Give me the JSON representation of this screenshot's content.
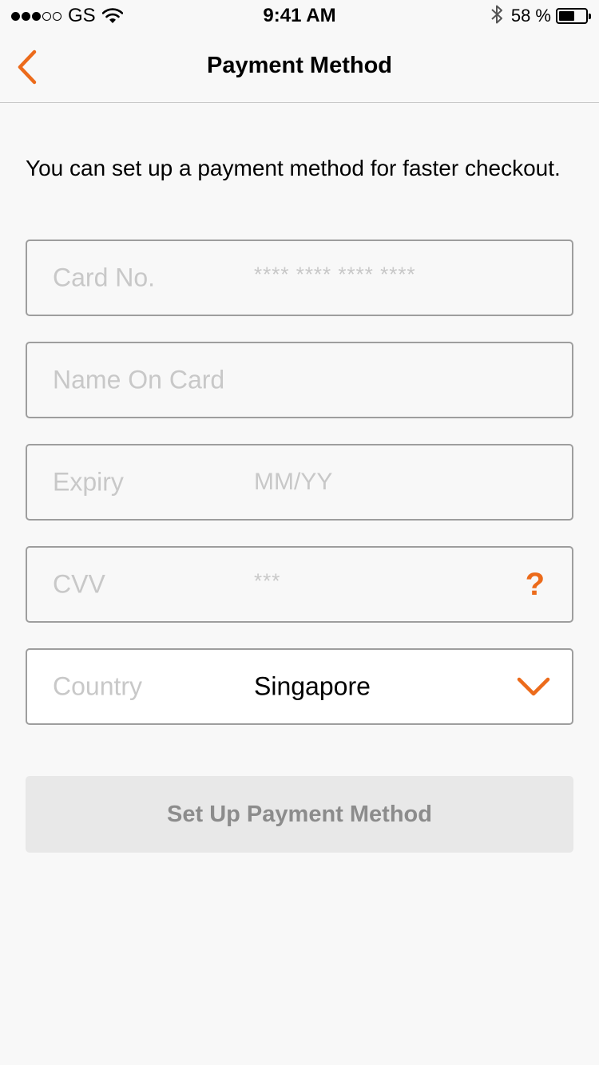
{
  "status_bar": {
    "carrier": "GS",
    "signal_full": 3,
    "signal_total": 5,
    "time": "9:41 AM",
    "battery_percent_text": "58 %",
    "battery_level": 0.58
  },
  "nav": {
    "title": "Payment Method",
    "back_icon": "chevron-left-icon",
    "accent_color": "#ec6b1b"
  },
  "intro_text": "You can set up a payment method for faster checkout.",
  "form": {
    "card_no": {
      "label": "Card No.",
      "placeholder": "**** **** **** ****"
    },
    "name_on_card": {
      "label": "Name On Card"
    },
    "expiry": {
      "label": "Expiry",
      "placeholder": "MM/YY"
    },
    "cvv": {
      "label": "CVV",
      "placeholder": "***",
      "help_icon": "?"
    },
    "country": {
      "label": "Country",
      "value": "Singapore",
      "dropdown_icon": "chevron-down-icon"
    }
  },
  "submit_button": {
    "label": "Set Up Payment Method",
    "enabled": false
  }
}
